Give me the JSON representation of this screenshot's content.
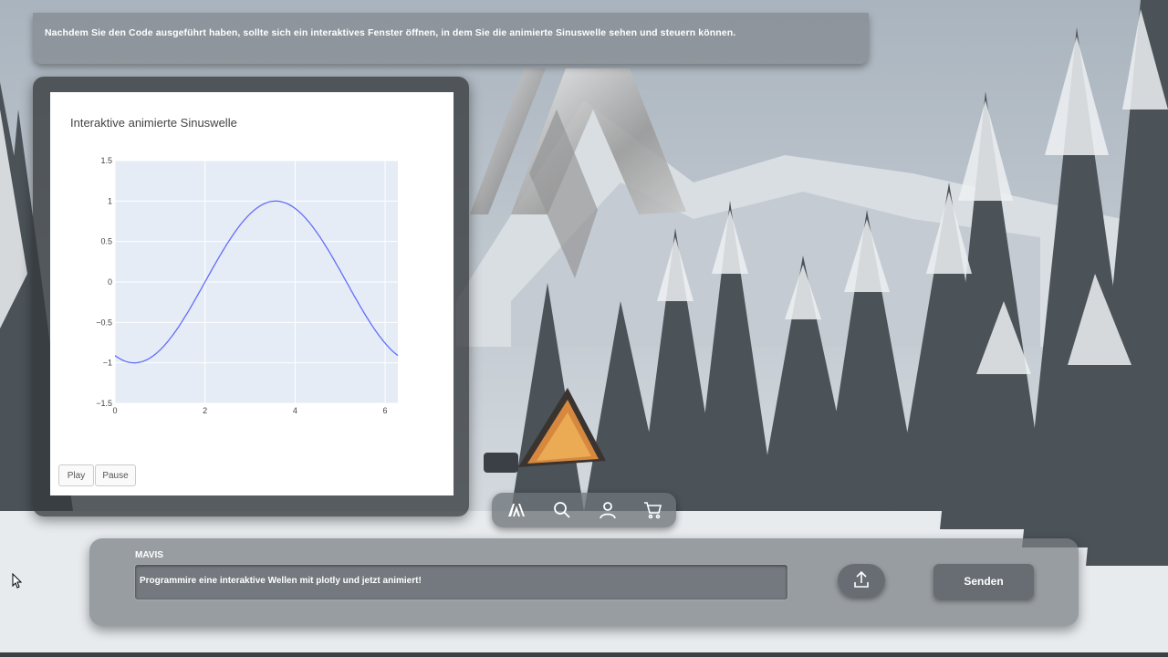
{
  "top_message": {
    "text": "Nachdem Sie den Code ausgeführt haben, sollte sich ein interaktives Fenster öffnen, in dem Sie die animierte Sinuswelle sehen und steuern können."
  },
  "chart_window": {
    "title": "Interaktive animierte Sinuswelle",
    "controls": {
      "play_label": "Play",
      "pause_label": "Pause"
    }
  },
  "chart_data": {
    "type": "line",
    "title": "Interaktive animierte Sinuswelle",
    "xlabel": "",
    "ylabel": "",
    "xlim": [
      0,
      6.283
    ],
    "ylim": [
      -1.5,
      1.5
    ],
    "x_ticks": [
      "0",
      "2",
      "4",
      "6"
    ],
    "y_ticks": [
      "1.5",
      "1",
      "0.5",
      "0",
      "−0.5",
      "−1",
      "−1.5"
    ],
    "grid": true,
    "series": [
      {
        "function": "sin(x - 2)",
        "phase_shift": 2.0,
        "color": "#636efa"
      }
    ]
  },
  "dock": {
    "items": [
      "logo-icon",
      "search-icon",
      "user-icon",
      "cart-icon"
    ]
  },
  "input_bar": {
    "assistant_name": "MAVIS",
    "prompt_value": "Programmire eine interaktive Wellen mit plotly und jetzt animiert!",
    "upload_icon": "upload-icon",
    "send_label": "Senden"
  },
  "colors": {
    "plot_bg": "#e5ecf6",
    "line": "#636efa",
    "panel_glass": "#3a3e42"
  }
}
